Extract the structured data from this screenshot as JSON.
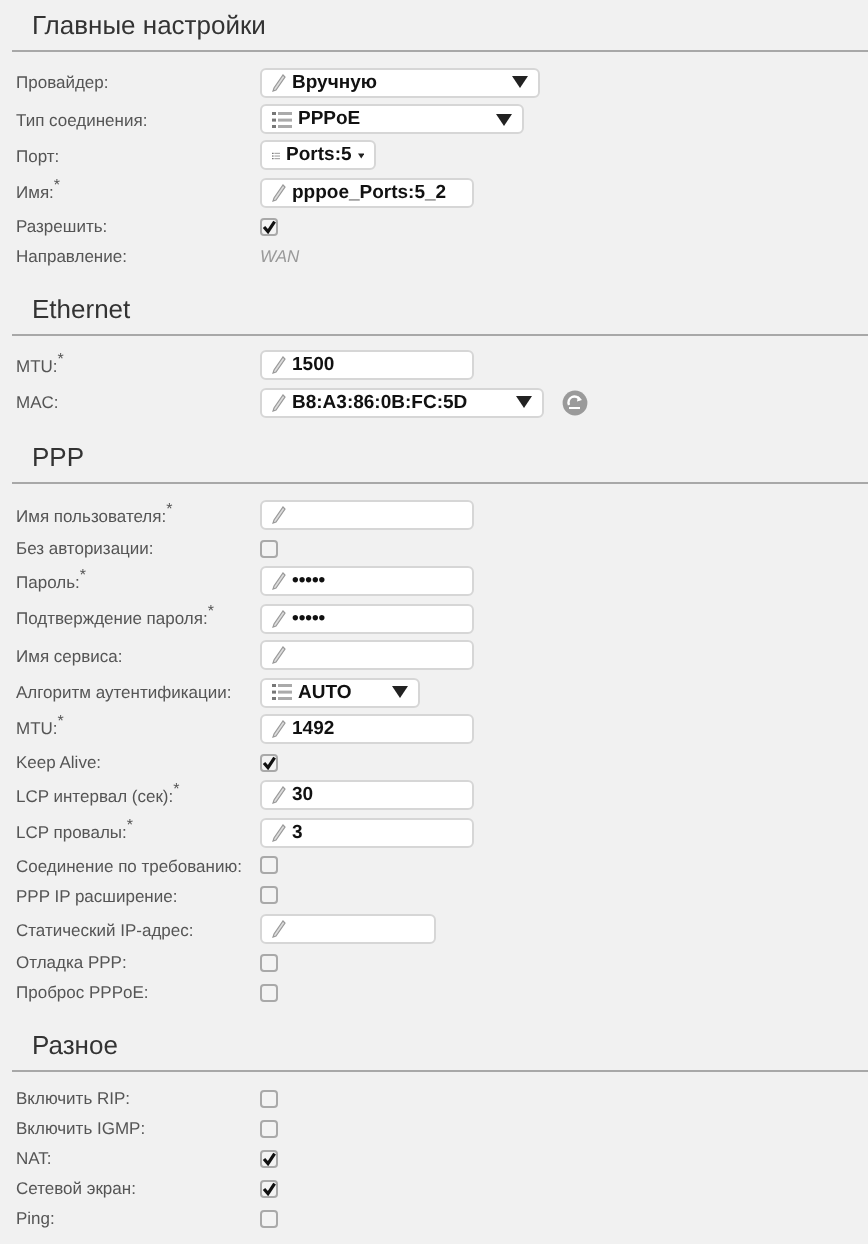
{
  "sections": [
    {
      "title": "Главные настройки",
      "fields": [
        {
          "kind": "combo",
          "label": "Провайдер:",
          "value": "Вручную"
        },
        {
          "kind": "select",
          "label": "Тип соединения:",
          "value": "PPPoE"
        },
        {
          "kind": "select",
          "label": "Порт:",
          "value": "Ports:5"
        },
        {
          "kind": "input",
          "label": "Имя:$^{*}$",
          "value": "pppoe_Ports:5_2"
        },
        {
          "kind": "checkbox",
          "label": "Разрешить:",
          "checked": true
        },
        {
          "kind": "text",
          "label": "Направление:",
          "value": "WAN"
        }
      ]
    },
    {
      "title": "Ethernet",
      "fields": [
        {
          "kind": "input",
          "label": "MTU:$^{*}$",
          "value": "1500"
        },
        {
          "kind": "combo",
          "label": "MAC:",
          "value": "B8:A3:86:0B:FC:5D",
          "refresh_button": true
        }
      ]
    },
    {
      "title": "PPP",
      "fields": [
        {
          "kind": "input",
          "label": "Имя пользователя:$^{*}$"
        },
        {
          "kind": "checkbox",
          "label": "Без авторизации:",
          "checked": false
        },
        {
          "kind": "input",
          "label": "Пароль:$^{*}$",
          "value": "•••••"
        },
        {
          "kind": "input",
          "label": "Подтверждение пароля:$^{*}$",
          "value": "•••••"
        },
        {
          "kind": "input",
          "label": "Имя сервиса:"
        },
        {
          "kind": "select",
          "label": "Алгоритм аутентификации:",
          "value": "AUTO"
        },
        {
          "kind": "input",
          "label": "MTU:$^{*}$",
          "value": "1492"
        },
        {
          "kind": "checkbox",
          "label": "Keep Alive:",
          "checked": true
        },
        {
          "kind": "input",
          "label": "LCP интервал (сек):$^{*}$",
          "value": "30"
        },
        {
          "kind": "input",
          "label": "LCP провалы:$^{*}$",
          "value": "3"
        },
        {
          "kind": "checkbox",
          "label": "Соединение по требованию:",
          "checked": false
        },
        {
          "kind": "checkbox",
          "label": "PPP IP расширение:",
          "checked": false
        },
        {
          "kind": "input",
          "label": "Статический IP-адрес:"
        },
        {
          "kind": "checkbox",
          "label": "Отладка PPP:",
          "checked": false
        },
        {
          "kind": "checkbox",
          "label": "Проброс PPPoE:",
          "checked": false
        }
      ]
    },
    {
      "title": "Разное",
      "fields": [
        {
          "kind": "checkbox",
          "label": "Включить RIP:",
          "checked": false
        },
        {
          "kind": "checkbox",
          "label": "Включить IGMP:",
          "checked": false
        },
        {
          "kind": "checkbox",
          "label": "NAT:",
          "checked": true
        },
        {
          "kind": "checkbox",
          "label": "Сетевой экран:",
          "checked": true
        },
        {
          "kind": "checkbox",
          "label": "Ping:",
          "checked": false
        }
      ]
    }
  ]
}
